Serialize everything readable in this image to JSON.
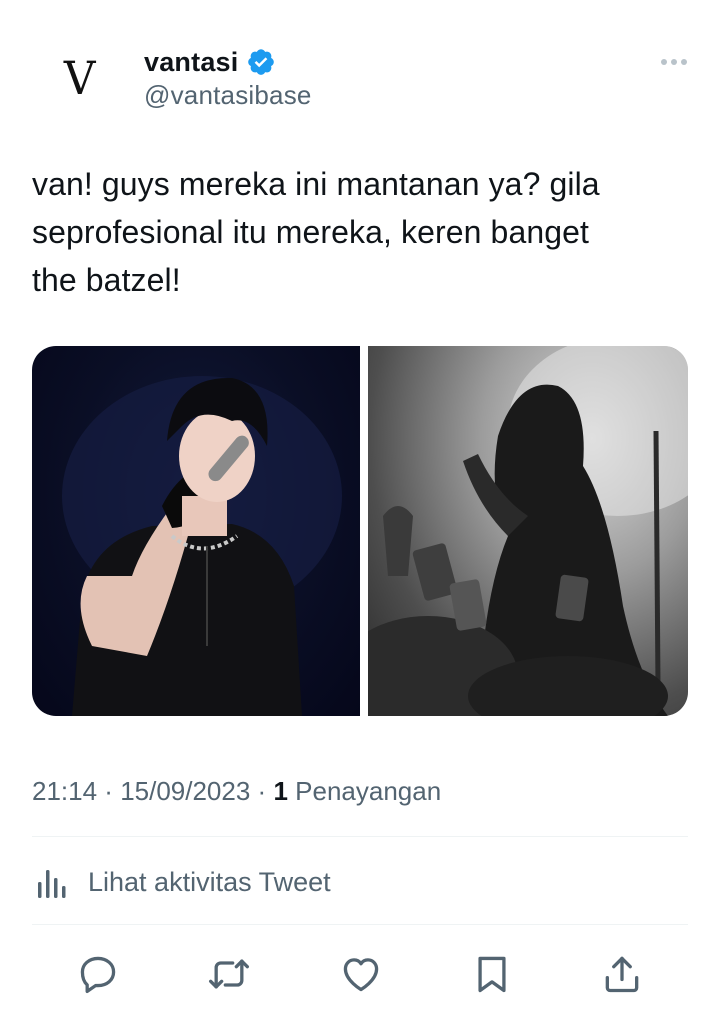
{
  "author": {
    "avatar_letter": "V",
    "display_name": "vantasi",
    "handle": "@vantasibase",
    "verified": true,
    "verified_color": "#1d9bf0"
  },
  "tweet": {
    "text_lines": [
      "van! guys mereka ini mantanan ya? gila",
      "seprofesional itu mereka, keren banget",
      "the batzel!"
    ]
  },
  "media": {
    "count": 2,
    "items": [
      {
        "type": "photo",
        "description_icon": "photo-performer-male"
      },
      {
        "type": "photo",
        "description_icon": "photo-performer-female"
      }
    ]
  },
  "meta": {
    "time": "21:14",
    "separator": " · ",
    "date": "15/09/2023",
    "views_count": "1",
    "views_label": "Penayangan"
  },
  "activity": {
    "icon": "analytics-icon",
    "label": "Lihat aktivitas Tweet"
  },
  "actions": [
    {
      "name": "reply",
      "icon": "reply-icon"
    },
    {
      "name": "retweet",
      "icon": "retweet-icon"
    },
    {
      "name": "like",
      "icon": "like-icon"
    },
    {
      "name": "bookmark",
      "icon": "bookmark-icon"
    },
    {
      "name": "share",
      "icon": "share-icon"
    }
  ],
  "colors": {
    "text_primary": "#0f1419",
    "text_secondary": "#536471",
    "divider": "#eff3f4",
    "accent": "#1d9bf0"
  }
}
